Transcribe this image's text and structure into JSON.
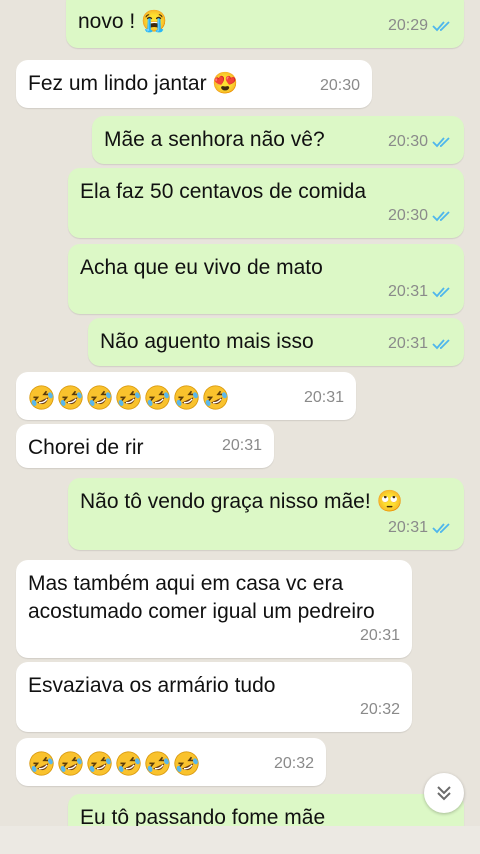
{
  "messages": [
    {
      "dir": "out",
      "text": "novo ! 😭",
      "time": "20:29",
      "ticks": true
    },
    {
      "dir": "in",
      "text": "Fez um lindo jantar 😍",
      "time": "20:30"
    },
    {
      "dir": "out",
      "text": "Mãe a senhora não vê?",
      "time": "20:30",
      "ticks": true
    },
    {
      "dir": "out",
      "text": "Ela faz 50 centavos de comida",
      "time": "20:30",
      "ticks": true
    },
    {
      "dir": "out",
      "text": "Acha que eu vivo de mato",
      "time": "20:31",
      "ticks": true
    },
    {
      "dir": "out",
      "text": "Não aguento mais isso",
      "time": "20:31",
      "ticks": true
    },
    {
      "dir": "in",
      "emoji": "rofl",
      "emoji_count": 7,
      "time": "20:31"
    },
    {
      "dir": "in",
      "text": "Chorei de rir",
      "time": "20:31"
    },
    {
      "dir": "out",
      "text": "Não tô vendo graça nisso mãe! 🙄",
      "time": "20:31",
      "ticks": true
    },
    {
      "dir": "in",
      "text": "Mas também aqui em casa vc era\nacostumado comer igual um pedreiro",
      "time": "20:31"
    },
    {
      "dir": "in",
      "text": "Esvaziava os armário tudo",
      "time": "20:32"
    },
    {
      "dir": "in",
      "emoji": "rofl",
      "emoji_count": 6,
      "time": "20:32"
    },
    {
      "dir": "out",
      "text": "Eu tô passando fome mãe",
      "time": "",
      "ticks": false
    }
  ],
  "icons": {
    "scroll_down": "double-chevron-down-icon",
    "read_receipt": "double-check-icon",
    "emoji": "rolling-on-floor-laughing-emoji"
  },
  "colors": {
    "incoming": "#ffffff",
    "outgoing": "#dcf8c6",
    "ticks": "#4fb6ec",
    "time": "#8a8a8a"
  }
}
